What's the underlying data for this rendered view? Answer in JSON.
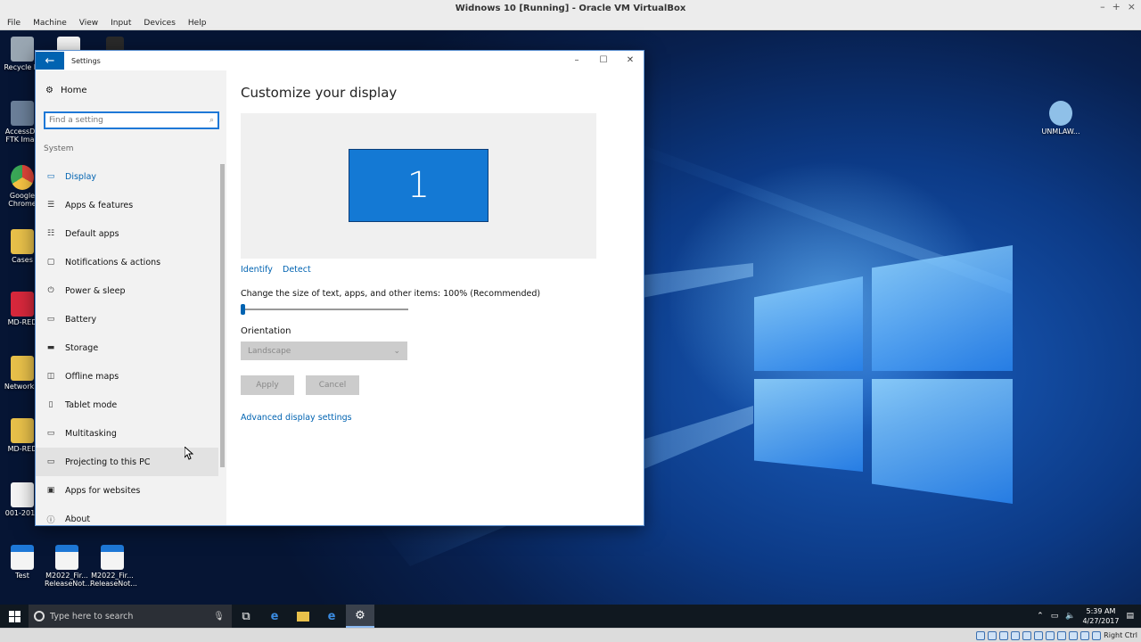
{
  "vbox": {
    "title": "Widnows 10 [Running] - Oracle VM VirtualBox",
    "menu": [
      "File",
      "Machine",
      "View",
      "Input",
      "Devices",
      "Help"
    ],
    "window_buttons": [
      "–",
      "+",
      "×"
    ],
    "host_key": "Right Ctrl"
  },
  "desktop": {
    "icons": [
      {
        "label": "Recycle Bi",
        "icon": "recycle-bin-icon",
        "color": "#9aa7b3"
      },
      {
        "label": "AccessDa FTK Imag",
        "icon": "ftk-imager-icon",
        "color": "#6b7f99"
      },
      {
        "label": "Google Chrome",
        "icon": "chrome-icon",
        "color": "#e0463a"
      },
      {
        "label": "Cases",
        "icon": "folder-icon",
        "color": "#e8c04a"
      },
      {
        "label": "MD-RED",
        "icon": "md-red-icon",
        "color": "#d8283c"
      },
      {
        "label": "NetworkM",
        "icon": "folder-icon",
        "color": "#e8c04a"
      },
      {
        "label": "MD-RED",
        "icon": "folder-icon",
        "color": "#e8c04a"
      },
      {
        "label": "001-2016",
        "icon": "document-icon",
        "color": "#f4f4f4"
      },
      {
        "label": "Test",
        "icon": "edge-pdf-icon",
        "color": "#f4f4f4"
      },
      {
        "label": "M2022_Fir... ReleaseNot...",
        "icon": "edge-pdf-icon",
        "color": "#f4f4f4"
      },
      {
        "label": "M2022_Fir... ReleaseNot...",
        "icon": "edge-pdf-icon",
        "color": "#f4f4f4"
      },
      {
        "label": "UNMLAW...",
        "icon": "network-globe-icon",
        "color": "#8fc0e8"
      }
    ]
  },
  "settings": {
    "window_title": "Settings",
    "controls": [
      "–",
      "☐",
      "✕"
    ],
    "home_label": "Home",
    "search_placeholder": "Find a setting",
    "section": "System",
    "nav": [
      {
        "label": "Display",
        "icon": "monitor-icon",
        "glyph": "▭"
      },
      {
        "label": "Apps & features",
        "icon": "list-icon",
        "glyph": "☰"
      },
      {
        "label": "Default apps",
        "icon": "default-apps-icon",
        "glyph": "☷"
      },
      {
        "label": "Notifications & actions",
        "icon": "notification-icon",
        "glyph": "▢"
      },
      {
        "label": "Power & sleep",
        "icon": "power-icon",
        "glyph": "⏻"
      },
      {
        "label": "Battery",
        "icon": "battery-icon",
        "glyph": "▭"
      },
      {
        "label": "Storage",
        "icon": "storage-icon",
        "glyph": "▬"
      },
      {
        "label": "Offline maps",
        "icon": "map-icon",
        "glyph": "◫"
      },
      {
        "label": "Tablet mode",
        "icon": "tablet-icon",
        "glyph": "▯"
      },
      {
        "label": "Multitasking",
        "icon": "multitasking-icon",
        "glyph": "▭"
      },
      {
        "label": "Projecting to this PC",
        "icon": "projecting-icon",
        "glyph": "▭"
      },
      {
        "label": "Apps for websites",
        "icon": "apps-websites-icon",
        "glyph": "▣"
      },
      {
        "label": "About",
        "icon": "info-icon",
        "glyph": "ⓘ"
      }
    ],
    "active_index": 0,
    "hover_index": 10,
    "accent": "#0063b1"
  },
  "display": {
    "title": "Customize your display",
    "monitor_number": "1",
    "identify": "Identify",
    "detect": "Detect",
    "scale_label": "Change the size of text, apps, and other items: 100% (Recommended)",
    "scale_value": 0,
    "orientation_label": "Orientation",
    "orientation_value": "Landscape",
    "apply": "Apply",
    "cancel": "Cancel",
    "advanced": "Advanced display settings"
  },
  "taskbar": {
    "search_placeholder": "Type here to search",
    "time": "5:39 AM",
    "date": "4/27/2017"
  }
}
